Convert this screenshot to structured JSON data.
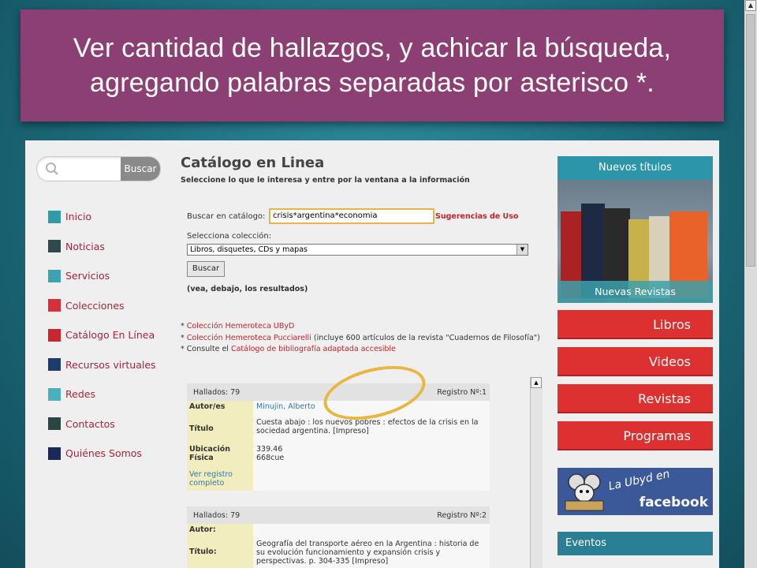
{
  "banner": {
    "line1": "Ver cantidad de hallazgos, y achicar la búsqueda,",
    "line2": "agregando palabras separadas por asterisco *."
  },
  "sidebar": {
    "search_button": "Buscar",
    "items": [
      {
        "label": "Inicio",
        "color": "#2f9aa8"
      },
      {
        "label": "Noticias",
        "color": "#2e4a4a"
      },
      {
        "label": "Servicios",
        "color": "#3ba4b0"
      },
      {
        "label": "Colecciones",
        "color": "#d6313a"
      },
      {
        "label": "Catálogo En Línea",
        "color": "#c9262e"
      },
      {
        "label": "Recursos virtuales",
        "color": "#1d3b6e"
      },
      {
        "label": "Redes",
        "color": "#4bb0be"
      },
      {
        "label": "Contactos",
        "color": "#2a4644"
      },
      {
        "label": "Quiénes Somos",
        "color": "#182a5c"
      }
    ]
  },
  "main": {
    "title": "Catálogo en Linea",
    "subtitle": "Seleccione lo que le interesa y entre por la ventana a la información",
    "search_label": "Buscar en catálogo:",
    "search_value": "crisis*argentina*economia",
    "suggestions": "Sugerencias de Uso",
    "collection_label": "Selecciona colección:",
    "collection_value": "Libros, disquetes, CDs y mapas",
    "buscar_button": "Buscar",
    "note": "(vea, debajo, los resultados)",
    "links": {
      "l1": "Colección Hemeroteca UByD",
      "l2": "Colección Hemeroteca Pucciarelli",
      "l2_suffix": "(incluye 600 artículos de la revista \"Cuadernos de Filosofía\")",
      "l3_prefix": "Consulte el",
      "l3": "Catálogo de bibliografía adaptada accesible"
    },
    "records": [
      {
        "hallados": "Hallados: 79",
        "registro": "Registro Nº:1",
        "autor_k": "Autor/es",
        "autor_v": "Minujin, Alberto",
        "titulo_k": "Título",
        "titulo_v": "Cuesta abajo : los nuevos pobres : efectos de la crisis en la sociedad argentina. [Impreso]",
        "ubic_k": "Ubicación Física",
        "ubic_v1": "339.46",
        "ubic_v2": "668cue",
        "ver": "Ver registro completo"
      },
      {
        "hallados": "Hallados: 79",
        "registro": "Registro Nº:2",
        "autor_k": "Autor:",
        "titulo_k": "Título:",
        "titulo_v": "Geografía del transporte aéreo en la Argentina : historia de su evolución funcionamiento y expansión crisis y perspectivas. p. 304-335 [Impreso]"
      }
    ]
  },
  "right": {
    "nuevos": "Nuevos títulos",
    "revistas_caption": "Nuevas Revistas",
    "buttons": [
      "Libros",
      "Videos",
      "Revistas",
      "Programas"
    ],
    "fb_text": "La Ubyd en",
    "fb_word": "facebook",
    "eventos": "Eventos"
  }
}
